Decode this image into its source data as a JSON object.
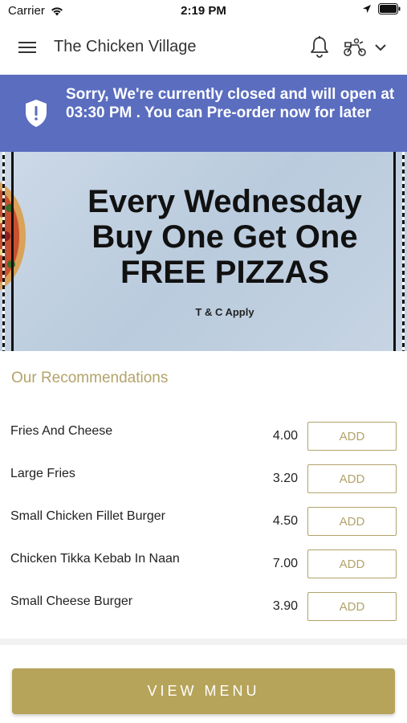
{
  "status_bar": {
    "carrier": "Carrier",
    "time": "2:19 PM",
    "icons": [
      "wifi-icon",
      "location-arrow-icon",
      "battery-icon"
    ]
  },
  "header": {
    "title": "The Chicken Village",
    "icons": [
      "hamburger-menu-icon",
      "bell-icon",
      "scooter-icon",
      "chevron-down-icon"
    ]
  },
  "closed_banner": {
    "message": "Sorry, We're currently closed and will open at 03:30 PM . You can Pre-order now for later",
    "icon": "shield-alert-icon",
    "color": "#5a6dbf"
  },
  "promo": {
    "heading": "Every Wednesday Buy One Get One FREE PIZZAS",
    "heading_lines": [
      "Every Wednesday",
      "Buy One Get One",
      "FREE PIZZAS"
    ],
    "terms": "T & C Apply"
  },
  "recommendations": {
    "heading": "Our Recommendations",
    "items": [
      {
        "name": "Fries And Cheese",
        "price": "4.00",
        "button": "ADD"
      },
      {
        "name": "Large Fries",
        "price": "3.20",
        "button": "ADD"
      },
      {
        "name": "Small Chicken Fillet Burger",
        "price": "4.50",
        "button": "ADD"
      },
      {
        "name": "Chicken Tikka Kebab In Naan",
        "price": "7.00",
        "button": "ADD"
      },
      {
        "name": "Small Cheese Burger",
        "price": "3.90",
        "button": "ADD"
      }
    ]
  },
  "footer": {
    "view_menu_label": "VIEW MENU"
  },
  "colors": {
    "accent": "#b3a36a",
    "banner": "#5a6dbf",
    "button": "#b6a45a"
  }
}
